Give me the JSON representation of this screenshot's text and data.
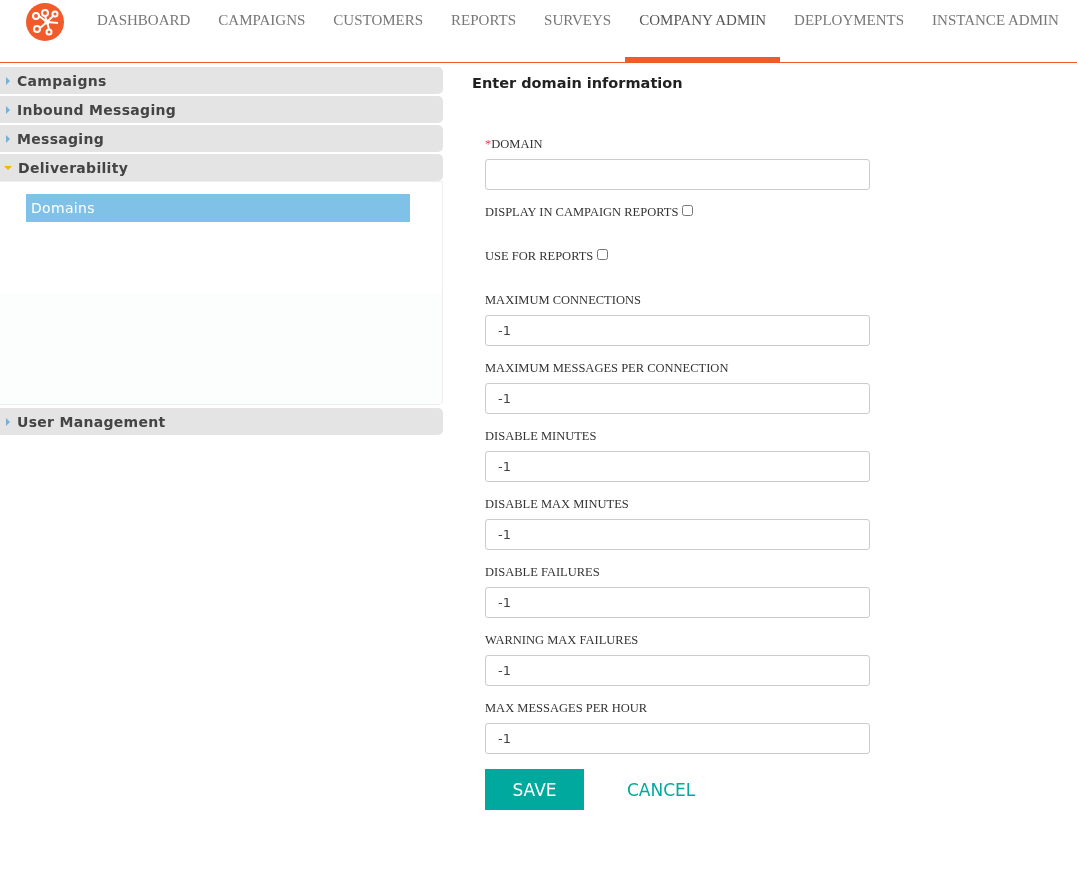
{
  "nav": {
    "tabs": [
      {
        "label": "DASHBOARD",
        "selected": false
      },
      {
        "label": "CAMPAIGNS",
        "selected": false
      },
      {
        "label": "CUSTOMERS",
        "selected": false
      },
      {
        "label": "REPORTS",
        "selected": false
      },
      {
        "label": "SURVEYS",
        "selected": false
      },
      {
        "label": "COMPANY ADMIN",
        "selected": true
      },
      {
        "label": "DEPLOYMENTS",
        "selected": false
      },
      {
        "label": "INSTANCE ADMIN",
        "selected": false
      }
    ]
  },
  "sidebar": {
    "sections": [
      {
        "label": "Campaigns",
        "expanded": false
      },
      {
        "label": "Inbound Messaging",
        "expanded": false
      },
      {
        "label": "Messaging",
        "expanded": false
      },
      {
        "label": "Deliverability",
        "expanded": true,
        "items": [
          {
            "label": "Domains",
            "selected": true
          }
        ]
      },
      {
        "label": "User Management",
        "expanded": false
      }
    ]
  },
  "form": {
    "title": "Enter domain information",
    "fields": [
      {
        "kind": "text",
        "label": "DOMAIN",
        "required": true
      },
      {
        "kind": "checkbox",
        "label": "DISPLAY IN CAMPAIGN REPORTS",
        "checked": false
      },
      {
        "kind": "checkbox",
        "label": "USE FOR REPORTS",
        "checked": false
      },
      {
        "kind": "text",
        "label": "MAXIMUM CONNECTIONS",
        "required": false,
        "value": "-1"
      },
      {
        "kind": "text",
        "label": "MAXIMUM MESSAGES PER CONNECTION",
        "required": false,
        "value": "-1"
      },
      {
        "kind": "text",
        "label": "DISABLE MINUTES",
        "required": false,
        "value": "-1"
      },
      {
        "kind": "text",
        "label": "DISABLE MAX MINUTES",
        "required": false,
        "value": "-1"
      },
      {
        "kind": "text",
        "label": "DISABLE FAILURES",
        "required": false,
        "value": "-1"
      },
      {
        "kind": "text",
        "label": "WARNING MAX FAILURES",
        "required": false,
        "value": "-1"
      },
      {
        "kind": "text",
        "label": "MAX MESSAGES PER HOUR",
        "required": false,
        "value": "-1"
      }
    ],
    "required_mark": "*",
    "buttons": [
      {
        "kind": "primary",
        "label": "SAVE"
      },
      {
        "kind": "link",
        "label": "CANCEL"
      }
    ]
  }
}
